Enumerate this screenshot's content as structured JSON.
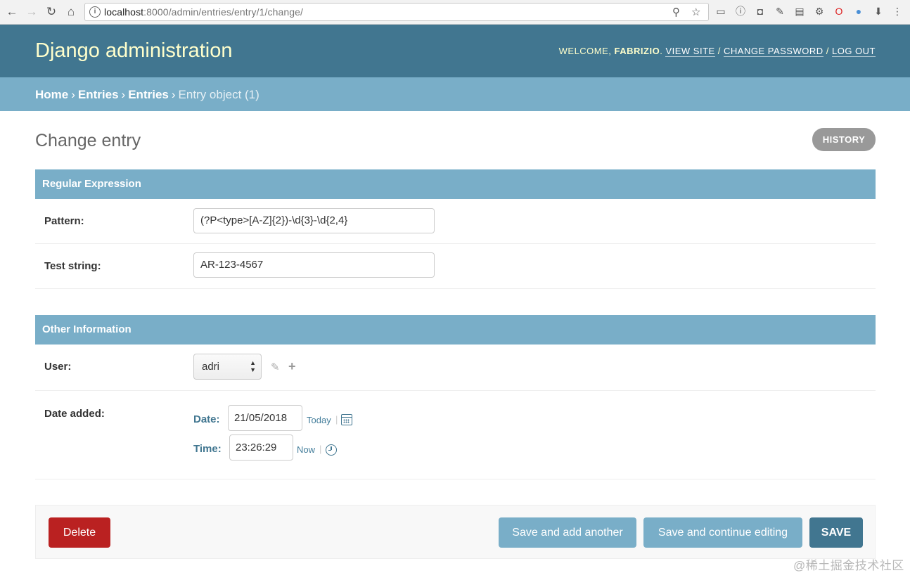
{
  "browser": {
    "url_host": "localhost",
    "url_rest": ":8000/admin/entries/entry/1/change/"
  },
  "header": {
    "site_name": "Django administration",
    "welcome": "Welcome,",
    "username": "fabrizio",
    "view_site": "View site",
    "change_password": "Change password",
    "log_out": "Log out"
  },
  "breadcrumbs": {
    "home": "Home",
    "app": "Entries",
    "model": "Entries",
    "current": "Entry object (1)"
  },
  "page": {
    "title": "Change entry",
    "history": "History"
  },
  "fieldsets": {
    "regex": {
      "title": "Regular Expression",
      "pattern_label": "Pattern:",
      "pattern_value": "(?P<type>[A-Z]{2})-\\d{3}-\\d{2,4}",
      "test_label": "Test string:",
      "test_value": "AR-123-4567"
    },
    "other": {
      "title": "Other Information",
      "user_label": "User:",
      "user_value": "adri",
      "date_added_label": "Date added:",
      "date_label": "Date:",
      "date_value": "21/05/2018",
      "today": "Today",
      "time_label": "Time:",
      "time_value": "23:26:29",
      "now": "Now"
    }
  },
  "actions": {
    "delete": "Delete",
    "save_add_another": "Save and add another",
    "save_continue": "Save and continue editing",
    "save": "SAVE"
  },
  "watermark": "@稀土掘金技术社区",
  "colors": {
    "header_bg": "#417690",
    "breadcrumb_bg": "#79aec8",
    "delete_bg": "#ba2121",
    "history_bg": "#999999"
  }
}
